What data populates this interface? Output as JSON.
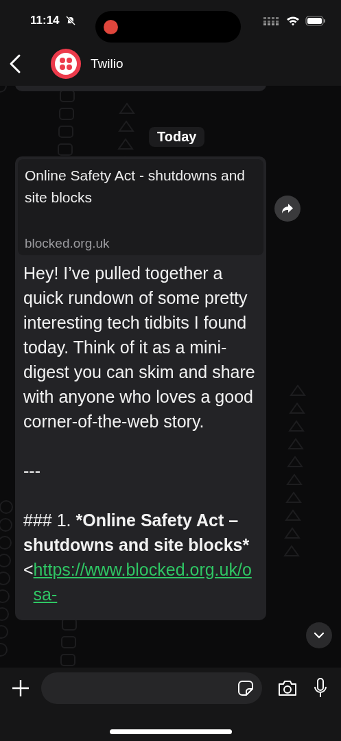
{
  "status_bar": {
    "time": "11:14",
    "silent": true,
    "recording": true
  },
  "header": {
    "contact": "Twilio"
  },
  "date_divider": "Today",
  "message": {
    "preview": {
      "title": "Online Safety Act - shutdowns and site blocks",
      "domain": "blocked.org.uk"
    },
    "body": "Hey! I’ve pulled together a quick rundown of some pretty interesting tech tidbits I found today. Think of it as a mini-digest you can skim and share with anyone who loves a good corner-of-the-web story.",
    "rule": "---",
    "heading": {
      "prefix": "### 1.",
      "title": "*Online Safety Act – shutdowns and site blocks*"
    },
    "link_open": "<",
    "link": "https://www.blocked.org.uk/osa-"
  }
}
